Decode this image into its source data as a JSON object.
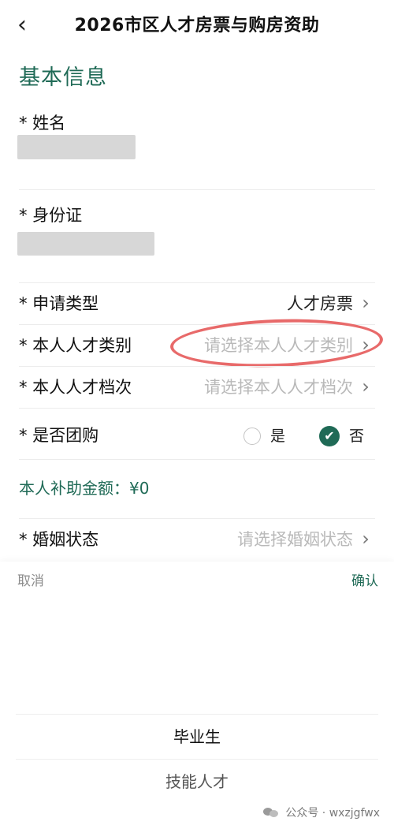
{
  "header": {
    "back_icon": "chevron-left-icon",
    "back_glyph": "‹",
    "title": "2026市区人才房票与购房资助"
  },
  "section": {
    "title": "基本信息"
  },
  "fields": {
    "name": {
      "label": "* 姓名"
    },
    "id_card": {
      "label": "* 身份证"
    },
    "apply_type": {
      "label": "* 申请类型",
      "value": "人才房票"
    },
    "talent_category": {
      "label": "* 本人人才类别",
      "placeholder": "请选择本人人才类别"
    },
    "talent_level": {
      "label": "* 本人人才档次",
      "placeholder": "请选择本人人才档次"
    },
    "group_buy": {
      "label": "* 是否团购",
      "options": [
        "是",
        "否"
      ],
      "selected": "否"
    },
    "marital": {
      "label": "* 婚姻状态",
      "placeholder": "请选择婚姻状态"
    }
  },
  "subsidy": {
    "text": "本人补助金额：¥0"
  },
  "picker": {
    "cancel": "取消",
    "confirm": "确认",
    "options": [
      "毕业生",
      "技能人才"
    ]
  },
  "watermark": {
    "text": "公众号 · wxzjgfwx"
  },
  "colors": {
    "accent": "#1f6a56",
    "highlight": "#e86a6a",
    "placeholder": "#b9b9b9"
  }
}
